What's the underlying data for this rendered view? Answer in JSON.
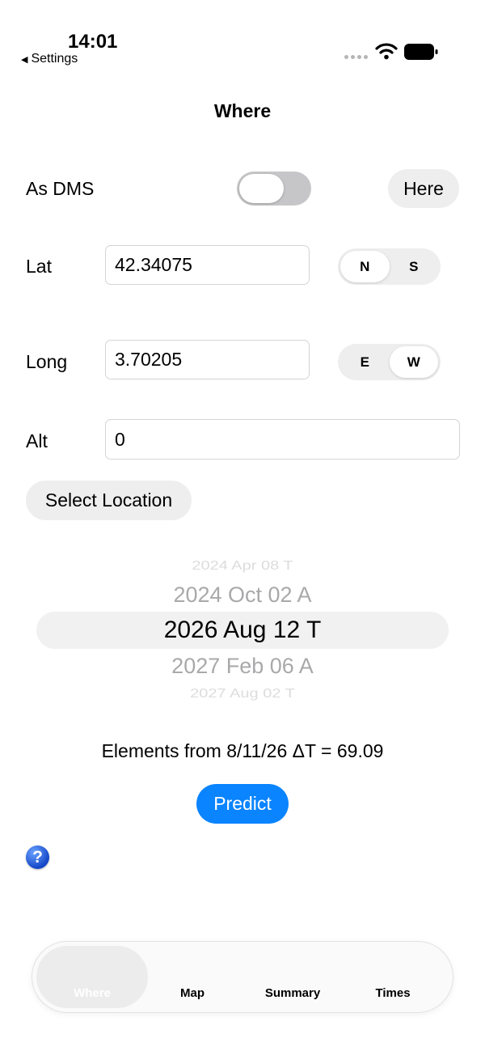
{
  "status_bar": {
    "time": "14:01",
    "back_label": "Settings"
  },
  "nav": {
    "title": "Where"
  },
  "dms": {
    "label": "As DMS",
    "enabled": false
  },
  "here_button": "Here",
  "lat": {
    "label": "Lat",
    "value": "42.34075",
    "options": [
      "N",
      "S"
    ],
    "selected": "N"
  },
  "long": {
    "label": "Long",
    "value": "3.70205",
    "options": [
      "E",
      "W"
    ],
    "selected": "W"
  },
  "alt": {
    "label": "Alt",
    "value": "0"
  },
  "select_location": "Select Location",
  "picker": {
    "items": [
      "2024 Apr 08 T",
      "2024 Oct 02 A",
      "2026 Aug 12 T",
      "2027 Feb 06 A",
      "2027 Aug 02 T"
    ],
    "selected": "2026 Aug 12 T"
  },
  "elements_text": "Elements from 8/11/26 ΔT = 69.09",
  "predict_button": "Predict",
  "help_icon": "question-mark-icon",
  "tabs": [
    "Where",
    "Map",
    "Summary",
    "Times"
  ],
  "selected_tab": "Where",
  "colors": {
    "accent": "#0a84ff",
    "segment_bg": "#eeeeef",
    "toggle_off": "#c6c6c8"
  }
}
